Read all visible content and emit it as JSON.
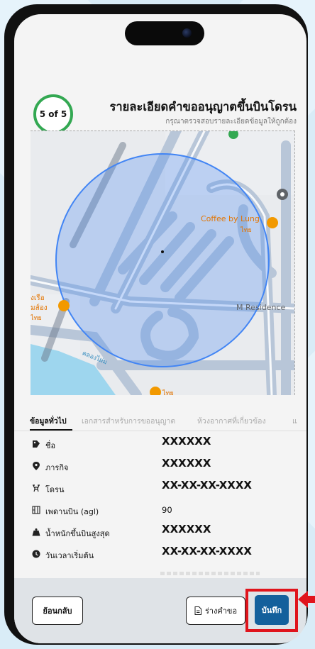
{
  "step": {
    "label": "5 of 5",
    "color": "#33a852"
  },
  "header": {
    "title": "รายละเอียดคำขออนุญาตขึ้นบินโดรน",
    "subtitle": "กรุณาตรวจสอบรายละเอียดข้อมูลให้ถูกต้อง"
  },
  "map": {
    "labels": {
      "cafe": "Coffee by Lung",
      "cafe_sub": "ไทย",
      "residence": "M Residence",
      "left_place": "งเรือ",
      "left_place_sub": "มส์อง",
      "left_place_sub2": "ไทย",
      "bottom_place": "ไทย",
      "river": "คลองไผ่ม"
    },
    "circle_color": "#4285f4"
  },
  "tabs": [
    {
      "label": "ข้อมูลทั่วไป",
      "active": true
    },
    {
      "label": "เอกสารสำหรับการขออนุญาต",
      "active": false
    },
    {
      "label": "ห้วงอากาศที่เกี่ยวข้อง",
      "active": false
    },
    {
      "label": "แ",
      "active": false
    }
  ],
  "details": [
    {
      "icon": "user-tag-icon",
      "label": "ชื่อ",
      "value": "XXXXXX"
    },
    {
      "icon": "map-pin-icon",
      "label": "ภารกิจ",
      "value": "XXXXXX"
    },
    {
      "icon": "drone-icon",
      "label": "โดรน",
      "value": "XX-XX-XX-XXXX"
    },
    {
      "icon": "altitude-icon",
      "label": "เพดานบิน (agl)",
      "value": "90"
    },
    {
      "icon": "weight-icon",
      "label": "น้ำหนักขึ้นบินสูงสุด",
      "value": "XXXXXX"
    },
    {
      "icon": "clock-icon",
      "label": "วันเวลาเริ่มต้น",
      "value": "XX-XX-XX-XXXX"
    }
  ],
  "buttons": {
    "back": "ย้อนกลับ",
    "draft": "ร่างคำขอ",
    "save": "บันทึก"
  },
  "colors": {
    "save": "#14609c",
    "highlight": "#e0141c"
  }
}
